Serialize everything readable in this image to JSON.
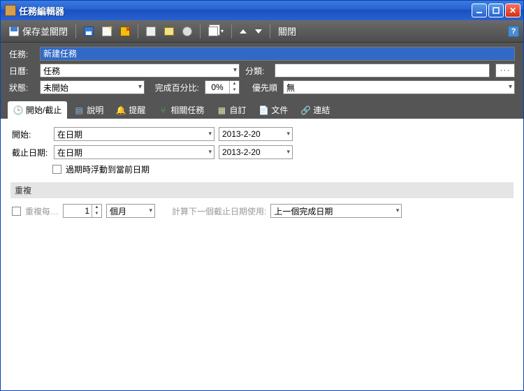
{
  "window": {
    "title": "任務編輯器"
  },
  "toolbar": {
    "save_close": "保存並關閉",
    "close": "關閉"
  },
  "form": {
    "label_task": "任務:",
    "task_value": "新建任務",
    "label_calendar": "日曆:",
    "calendar_value": "任務",
    "label_category": "分類:",
    "category_value": "",
    "label_status": "狀態:",
    "status_value": "未開始",
    "label_progress": "完成百分比:",
    "progress_value": "0%",
    "label_priority": "優先順",
    "priority_value": "無"
  },
  "tabs": [
    {
      "label": "開始/截止",
      "icon": "clock"
    },
    {
      "label": "說明",
      "icon": "doc"
    },
    {
      "label": "提醒",
      "icon": "bell"
    },
    {
      "label": "相關任務",
      "icon": "subtask"
    },
    {
      "label": "自訂",
      "icon": "page"
    },
    {
      "label": "文件",
      "icon": "file"
    },
    {
      "label": "連結",
      "icon": "link"
    }
  ],
  "startstop": {
    "label_start": "開始:",
    "start_mode": "在日期",
    "start_date": "2013-2-20",
    "label_due": "截止日期:",
    "due_mode": "在日期",
    "due_date": "2013-2-20",
    "float_label": "過期時浮動到當前日期",
    "section_repeat": "重複",
    "repeat_label": "重複每…",
    "repeat_interval": "1",
    "repeat_unit": "個月",
    "calc_label": "計算下一個截止日期使用:",
    "calc_value": "上一個完成日期"
  }
}
